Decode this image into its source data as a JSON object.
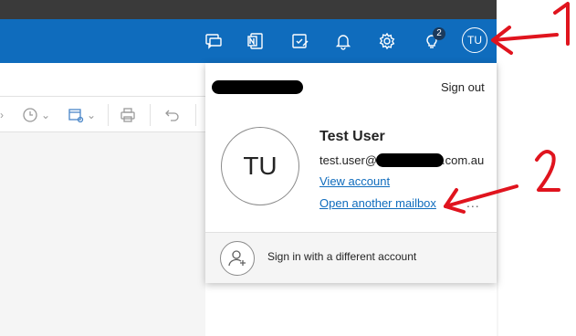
{
  "header": {
    "icons": [
      "chat-icon",
      "onenote-icon",
      "todo-icon",
      "bell-icon",
      "gear-icon",
      "lightbulb-icon"
    ],
    "tips_badge": "2",
    "avatar_initials": "TU"
  },
  "account_panel": {
    "sign_out": "Sign out",
    "avatar_initials": "TU",
    "user_name": "Test User",
    "email_prefix": "test.user@",
    "email_suffix": ".com.au",
    "view_account": "View account",
    "open_another_mailbox": "Open another mailbox",
    "more": "...",
    "sign_in_different": "Sign in with a different account"
  },
  "annotations": {
    "marker_1": "1",
    "marker_2": "2",
    "color": "#e0141e"
  }
}
